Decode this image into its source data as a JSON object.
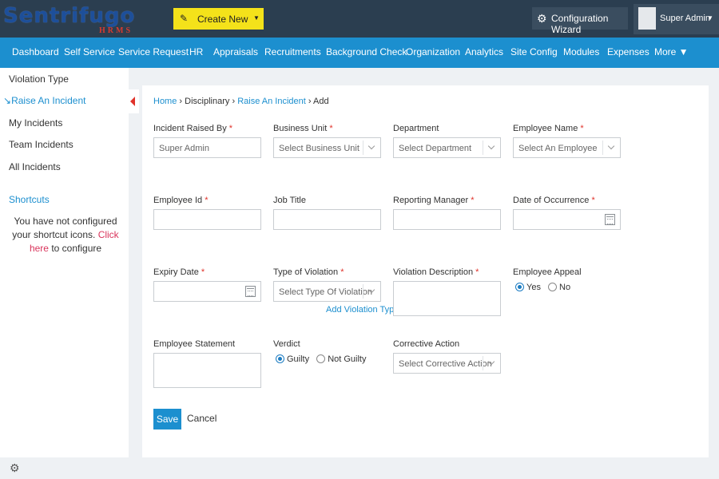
{
  "header": {
    "logo_text": "SentrifugoHRMS",
    "logo_brand": "Sentrifugo",
    "logo_sub": "HRMS",
    "create_new_label": "Create New",
    "config_wizard_label": "Configuration Wizard",
    "user_name": "Super Admin"
  },
  "nav": [
    "Dashboard",
    "Self Service",
    "Service Request",
    "HR",
    "Appraisals",
    "Recruitments",
    "Background Check",
    "Organization",
    "Analytics",
    "Site Config",
    "Modules",
    "Expenses",
    "More ▼"
  ],
  "sidebar": {
    "items": [
      "Violation Type",
      "Raise An Incident",
      "My Incidents",
      "Team Incidents",
      "All Incidents"
    ],
    "active_index": 1,
    "shortcuts_title": "Shortcuts",
    "shortcuts_msg_pre": "You have not configured your shortcut icons.",
    "shortcuts_link": "Click here",
    "shortcuts_msg_post": "to configure"
  },
  "breadcrumb": {
    "home": "Home",
    "sep": "›",
    "disciplinary": "Disciplinary",
    "raise": "Raise An Incident",
    "add": "Add"
  },
  "form": {
    "incident_raised_by": {
      "label": "Incident Raised By",
      "required": "*",
      "value": "Super Admin"
    },
    "business_unit": {
      "label": "Business Unit",
      "required": "*",
      "placeholder": "Select Business Unit"
    },
    "department": {
      "label": "Department",
      "placeholder": "Select Department"
    },
    "employee_name": {
      "label": "Employee Name",
      "required": "*",
      "placeholder": "Select An Employee"
    },
    "employee_id": {
      "label": "Employee Id",
      "required": "*",
      "value": ""
    },
    "job_title": {
      "label": "Job Title",
      "value": ""
    },
    "reporting_manager": {
      "label": "Reporting Manager",
      "required": "*",
      "value": ""
    },
    "date_of_occurrence": {
      "label": "Date of Occurrence",
      "required": "*",
      "value": ""
    },
    "expiry_date": {
      "label": "Expiry Date",
      "required": "*",
      "value": ""
    },
    "type_of_violation": {
      "label": "Type of Violation",
      "required": "*",
      "placeholder": "Select Type Of Violation",
      "add_link": "Add Violation Type"
    },
    "violation_description": {
      "label": "Violation Description",
      "required": "*",
      "value": ""
    },
    "employee_appeal": {
      "label": "Employee Appeal",
      "options": [
        "Yes",
        "No"
      ],
      "selected": "Yes"
    },
    "employee_statement": {
      "label": "Employee Statement",
      "value": ""
    },
    "verdict": {
      "label": "Verdict",
      "options": [
        "Guilty",
        "Not Guilty"
      ],
      "selected": "Guilty"
    },
    "corrective_action": {
      "label": "Corrective Action",
      "placeholder": "Select Corrective Action"
    },
    "save_label": "Save",
    "cancel_label": "Cancel"
  },
  "colors": {
    "topbar": "#2b3e50",
    "nav": "#1c8fcf",
    "create_button": "#f4e21a",
    "required": "#e0322a",
    "link": "#1c8fcf",
    "shortcut_link": "#d9355c"
  }
}
